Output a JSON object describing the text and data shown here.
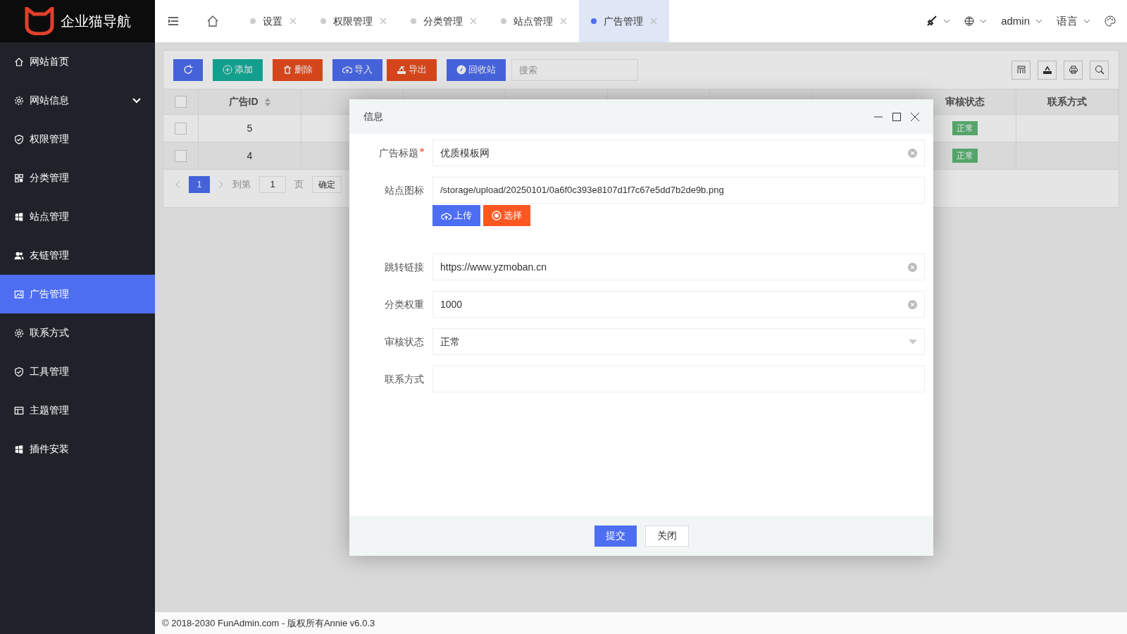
{
  "logo": {
    "title": "企业猫导航"
  },
  "sidebar": {
    "items": [
      {
        "label": "网站首页",
        "selected": false
      },
      {
        "label": "网站信息",
        "selected": false,
        "expanded": false
      },
      {
        "label": "权限管理",
        "selected": false
      },
      {
        "label": "分类管理",
        "selected": false
      },
      {
        "label": "站点管理",
        "selected": false
      },
      {
        "label": "友链管理",
        "selected": false
      },
      {
        "label": "广告管理",
        "selected": true
      },
      {
        "label": "联系方式",
        "selected": false
      },
      {
        "label": "工具管理",
        "selected": false
      },
      {
        "label": "主题管理",
        "selected": false
      },
      {
        "label": "插件安装",
        "selected": false
      }
    ]
  },
  "tabs": [
    {
      "label": "设置",
      "selected": false
    },
    {
      "label": "权限管理",
      "selected": false
    },
    {
      "label": "分类管理",
      "selected": false
    },
    {
      "label": "站点管理",
      "selected": false
    },
    {
      "label": "广告管理",
      "selected": true
    }
  ],
  "header_right": {
    "user": "admin",
    "language": "语言"
  },
  "toolbar": {
    "buttons": [
      {
        "label": "添加",
        "kind": "add"
      },
      {
        "label": "删除",
        "kind": "delete"
      },
      {
        "label": "导入",
        "kind": "import"
      },
      {
        "label": "导出",
        "kind": "export"
      },
      {
        "label": "回收站",
        "kind": "recycle"
      }
    ],
    "search": {
      "placeholder": "搜索"
    }
  },
  "table": {
    "all_checked": false,
    "columns": [
      {
        "label": "广告ID",
        "sortable": true
      },
      {
        "label": "审核状态"
      },
      {
        "label": "联系方式"
      }
    ],
    "rows": [
      {
        "id": "5",
        "status": "正常",
        "selected": false,
        "checked": false
      },
      {
        "id": "4",
        "status": "正常",
        "selected": true,
        "checked": false
      }
    ]
  },
  "pagination": {
    "page": "1",
    "goto_label": "到第",
    "goto_value": "1",
    "page_unit": "页",
    "confirm": "确定"
  },
  "dialog": {
    "title": "信息",
    "fields": [
      {
        "label": "广告标题",
        "required": true,
        "kind": "text",
        "value": "优质模板网",
        "clearable": true
      },
      {
        "label": "站点图标",
        "kind": "file",
        "value": "/storage/upload/20250101/0a6f0c393e8107d1f7c67e5dd7b2de9b.png",
        "upload": "上传",
        "choose": "选择"
      },
      {
        "label": "跳转链接",
        "kind": "text",
        "value": "https://www.yzmoban.cn",
        "clearable": true
      },
      {
        "label": "分类权重",
        "kind": "text",
        "value": "1000",
        "clearable": true
      },
      {
        "label": "审核状态",
        "kind": "select",
        "value": "正常"
      },
      {
        "label": "联系方式",
        "kind": "text",
        "clearable": false
      }
    ],
    "buttons": [
      {
        "label": "提交",
        "kind": "primary"
      },
      {
        "label": "关闭",
        "kind": "plain"
      }
    ]
  },
  "footer": "© 2018-2030 FunAdmin.com - 版权所有Annie v6.0.3"
}
